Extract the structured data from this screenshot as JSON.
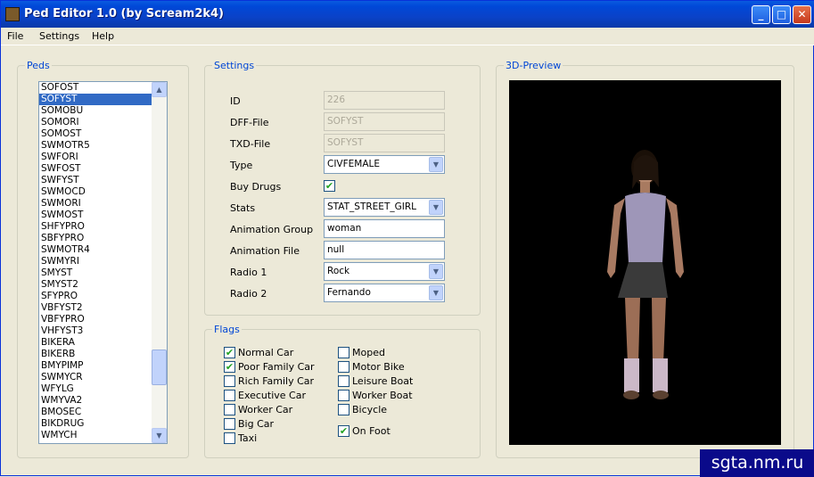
{
  "window": {
    "title": "Ped Editor 1.0 (by Scream2k4)",
    "controls": {
      "minimize": "_",
      "maximize": "□",
      "close": "✕"
    }
  },
  "menu": [
    "File",
    "Settings",
    "Help"
  ],
  "peds": {
    "title": "Peds",
    "items": [
      "SOFOST",
      "SOFYST",
      "SOMOBU",
      "SOMORI",
      "SOMOST",
      "SWMOTR5",
      "SWFORI",
      "SWFOST",
      "SWFYST",
      "SWMOCD",
      "SWMORI",
      "SWMOST",
      "SHFYPRO",
      "SBFYPRO",
      "SWMOTR4",
      "SWMYRI",
      "SMYST",
      "SMYST2",
      "SFYPRO",
      "VBFYST2",
      "VBFYPRO",
      "VHFYST3",
      "BIKERA",
      "BIKERB",
      "BMYPIMP",
      "SWMYCR",
      "WFYLG",
      "WMYVA2",
      "BMOSEC",
      "BIKDRUG",
      "WMYCH"
    ],
    "selected": "SOFYST"
  },
  "settings": {
    "title": "Settings",
    "id": {
      "label": "ID",
      "value": "226"
    },
    "dff": {
      "label": "DFF-File",
      "value": "SOFYST"
    },
    "txd": {
      "label": "TXD-File",
      "value": "SOFYST"
    },
    "type": {
      "label": "Type",
      "value": "CIVFEMALE"
    },
    "buy_drugs": {
      "label": "Buy Drugs",
      "checked": true
    },
    "stats": {
      "label": "Stats",
      "value": "STAT_STREET_GIRL"
    },
    "anim_group": {
      "label": "Animation Group",
      "value": "woman"
    },
    "anim_file": {
      "label": "Animation File",
      "value": "null"
    },
    "radio1": {
      "label": "Radio 1",
      "value": "Rock"
    },
    "radio2": {
      "label": "Radio 2",
      "value": "Fernando"
    }
  },
  "flags": {
    "title": "Flags",
    "left": [
      {
        "label": "Normal Car",
        "checked": true
      },
      {
        "label": "Poor Family Car",
        "checked": true
      },
      {
        "label": "Rich Family Car",
        "checked": false
      },
      {
        "label": "Executive Car",
        "checked": false
      },
      {
        "label": "Worker Car",
        "checked": false
      },
      {
        "label": "Big Car",
        "checked": false
      },
      {
        "label": "Taxi",
        "checked": false
      }
    ],
    "right": [
      {
        "label": "Moped",
        "checked": false
      },
      {
        "label": "Motor Bike",
        "checked": false
      },
      {
        "label": "Leisure Boat",
        "checked": false
      },
      {
        "label": "Worker Boat",
        "checked": false
      },
      {
        "label": "Bicycle",
        "checked": false
      },
      {
        "label": "On Foot",
        "checked": true
      }
    ]
  },
  "preview": {
    "title": "3D-Preview"
  },
  "watermark": "sgta.nm.ru",
  "colors": {
    "titlebar": "#0a4fd8",
    "selection": "#316ac5",
    "group_title": "#0046d5",
    "check": "#21a121"
  }
}
